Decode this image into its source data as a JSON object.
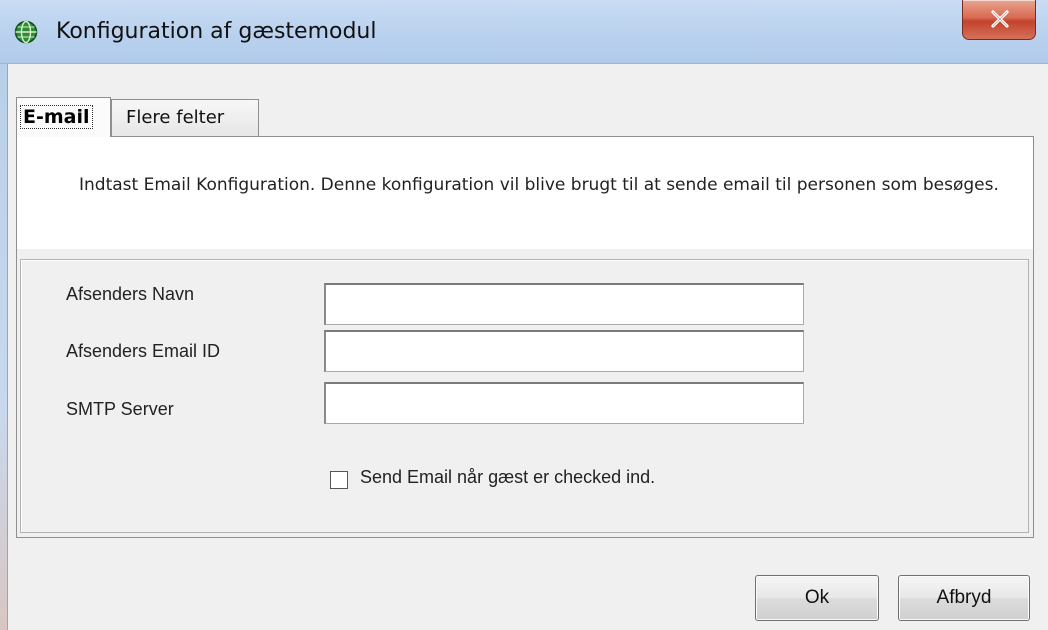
{
  "window": {
    "title": "Konfiguration af gæstemodul",
    "icon": "globe-icon",
    "close_icon": "close-icon"
  },
  "tabs": [
    {
      "label": "E-mail",
      "active": true
    },
    {
      "label": "Flere felter",
      "active": false
    }
  ],
  "description": "Indtast Email Konfiguration. Denne konfiguration vil blive brugt til at sende email til personen som besøges.",
  "form": {
    "sender_name": {
      "label": "Afsenders Navn",
      "value": ""
    },
    "sender_email": {
      "label": "Afsenders Email ID",
      "value": ""
    },
    "smtp_server": {
      "label": "SMTP Server",
      "value": ""
    },
    "send_email_checkbox": {
      "label": "Send Email når gæst er checked ind.",
      "checked": false
    }
  },
  "buttons": {
    "ok": "Ok",
    "cancel": "Afbryd"
  },
  "colors": {
    "titlebar": "#bcd3ef",
    "close_button": "#c2432c",
    "dialog_background": "#f0f0f0"
  }
}
